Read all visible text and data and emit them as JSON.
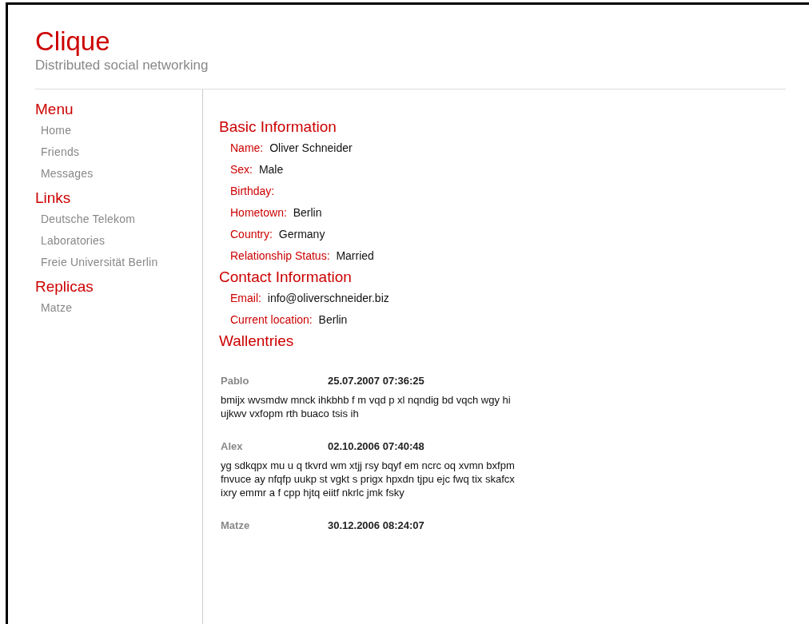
{
  "header": {
    "title": "Clique",
    "subtitle": "Distributed social networking"
  },
  "sidebar": [
    {
      "heading": "Menu",
      "items": [
        "Home",
        "Friends",
        "Messages"
      ]
    },
    {
      "heading": "Links",
      "items": [
        "Deutsche Telekom",
        "Laboratories",
        "Freie Universität Berlin"
      ]
    },
    {
      "heading": "Replicas",
      "items": [
        "Matze"
      ]
    }
  ],
  "sections": [
    {
      "heading": "Basic Information",
      "fields": [
        {
          "label": "Name:",
          "value": "Oliver Schneider"
        },
        {
          "label": "Sex:",
          "value": "Male"
        },
        {
          "label": "Birthday:"
        },
        {
          "label": "Hometown:",
          "value": "Berlin"
        },
        {
          "label": "Country:",
          "value": "Germany"
        },
        {
          "label": "Relationship Status:",
          "value": "Married"
        }
      ]
    },
    {
      "heading": "Contact Information",
      "fields": [
        {
          "label": "Email:",
          "value": "info@oliverschneider.biz"
        },
        {
          "label": "Current location:",
          "value": "Berlin"
        }
      ]
    }
  ],
  "wall": {
    "heading": "Wallentries",
    "entries": [
      {
        "author": "Pablo",
        "date": "25.07.2007 07:36:25",
        "text": "bmijx wvsmdw mnck ihkbhb f m vqd p xl nqndig bd vqch wgy hi ujkwv vxfopm rth buaco tsis ih"
      },
      {
        "author": "Alex",
        "date": "02.10.2006 07:40:48",
        "text": "yg sdkqpx mu u q tkvrd wm xtjj rsy bqyf em ncrc oq xvmn bxfpm fnvuce ay nfqfp uukp st vgkt s prigx hpxdn tjpu ejc fwq tix skafcx ixry emmr a f cpp hjtq eiitf nkrlc jmk fsky"
      },
      {
        "author": "Matze",
        "date": "30.12.2006 08:24:07"
      }
    ]
  }
}
